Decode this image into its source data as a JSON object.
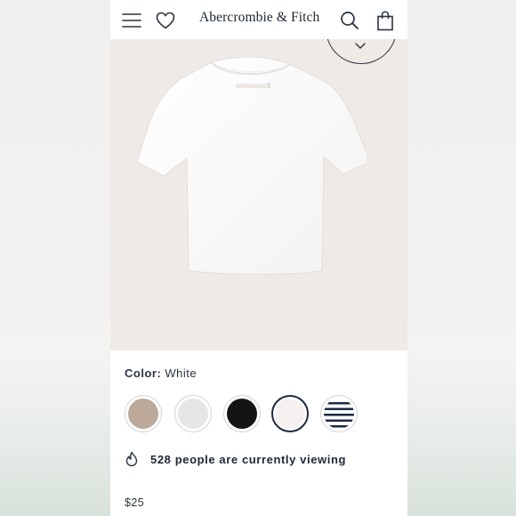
{
  "header": {
    "menu_icon": "hamburger-menu-icon",
    "wishlist_icon": "heart-icon",
    "brand": "Abercrombie & Fitch",
    "search_icon": "search-icon",
    "bag_icon": "shopping-bag-icon"
  },
  "hero": {
    "collapse_icon": "chevron-down-icon",
    "image": "white-crew-tee",
    "background": "#efeae6"
  },
  "color": {
    "label": "Color:",
    "value": "White",
    "swatches": [
      {
        "name": "taupe",
        "color": "#bca99a",
        "selected": false
      },
      {
        "name": "light-heather",
        "color": "#e6e6e6",
        "selected": false
      },
      {
        "name": "black",
        "color": "#141414",
        "selected": false
      },
      {
        "name": "white",
        "color": "#f6f1f1",
        "selected": true
      },
      {
        "name": "navy-stripe",
        "color": "#1c2a44",
        "selected": false
      }
    ]
  },
  "social_proof": {
    "icon": "flame-icon",
    "text": "528 people are currently viewing"
  },
  "price": "$25",
  "colors": {
    "navy": "#1c2a3c",
    "text": "#2b3440"
  }
}
